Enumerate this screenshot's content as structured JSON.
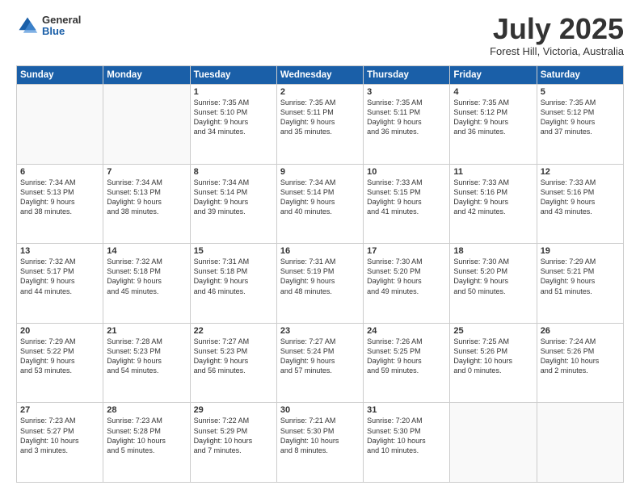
{
  "header": {
    "logo_general": "General",
    "logo_blue": "Blue",
    "month_title": "July 2025",
    "location": "Forest Hill, Victoria, Australia"
  },
  "days_of_week": [
    "Sunday",
    "Monday",
    "Tuesday",
    "Wednesday",
    "Thursday",
    "Friday",
    "Saturday"
  ],
  "weeks": [
    [
      {
        "num": "",
        "info": ""
      },
      {
        "num": "",
        "info": ""
      },
      {
        "num": "1",
        "info": "Sunrise: 7:35 AM\nSunset: 5:10 PM\nDaylight: 9 hours\nand 34 minutes."
      },
      {
        "num": "2",
        "info": "Sunrise: 7:35 AM\nSunset: 5:11 PM\nDaylight: 9 hours\nand 35 minutes."
      },
      {
        "num": "3",
        "info": "Sunrise: 7:35 AM\nSunset: 5:11 PM\nDaylight: 9 hours\nand 36 minutes."
      },
      {
        "num": "4",
        "info": "Sunrise: 7:35 AM\nSunset: 5:12 PM\nDaylight: 9 hours\nand 36 minutes."
      },
      {
        "num": "5",
        "info": "Sunrise: 7:35 AM\nSunset: 5:12 PM\nDaylight: 9 hours\nand 37 minutes."
      }
    ],
    [
      {
        "num": "6",
        "info": "Sunrise: 7:34 AM\nSunset: 5:13 PM\nDaylight: 9 hours\nand 38 minutes."
      },
      {
        "num": "7",
        "info": "Sunrise: 7:34 AM\nSunset: 5:13 PM\nDaylight: 9 hours\nand 38 minutes."
      },
      {
        "num": "8",
        "info": "Sunrise: 7:34 AM\nSunset: 5:14 PM\nDaylight: 9 hours\nand 39 minutes."
      },
      {
        "num": "9",
        "info": "Sunrise: 7:34 AM\nSunset: 5:14 PM\nDaylight: 9 hours\nand 40 minutes."
      },
      {
        "num": "10",
        "info": "Sunrise: 7:33 AM\nSunset: 5:15 PM\nDaylight: 9 hours\nand 41 minutes."
      },
      {
        "num": "11",
        "info": "Sunrise: 7:33 AM\nSunset: 5:16 PM\nDaylight: 9 hours\nand 42 minutes."
      },
      {
        "num": "12",
        "info": "Sunrise: 7:33 AM\nSunset: 5:16 PM\nDaylight: 9 hours\nand 43 minutes."
      }
    ],
    [
      {
        "num": "13",
        "info": "Sunrise: 7:32 AM\nSunset: 5:17 PM\nDaylight: 9 hours\nand 44 minutes."
      },
      {
        "num": "14",
        "info": "Sunrise: 7:32 AM\nSunset: 5:18 PM\nDaylight: 9 hours\nand 45 minutes."
      },
      {
        "num": "15",
        "info": "Sunrise: 7:31 AM\nSunset: 5:18 PM\nDaylight: 9 hours\nand 46 minutes."
      },
      {
        "num": "16",
        "info": "Sunrise: 7:31 AM\nSunset: 5:19 PM\nDaylight: 9 hours\nand 48 minutes."
      },
      {
        "num": "17",
        "info": "Sunrise: 7:30 AM\nSunset: 5:20 PM\nDaylight: 9 hours\nand 49 minutes."
      },
      {
        "num": "18",
        "info": "Sunrise: 7:30 AM\nSunset: 5:20 PM\nDaylight: 9 hours\nand 50 minutes."
      },
      {
        "num": "19",
        "info": "Sunrise: 7:29 AM\nSunset: 5:21 PM\nDaylight: 9 hours\nand 51 minutes."
      }
    ],
    [
      {
        "num": "20",
        "info": "Sunrise: 7:29 AM\nSunset: 5:22 PM\nDaylight: 9 hours\nand 53 minutes."
      },
      {
        "num": "21",
        "info": "Sunrise: 7:28 AM\nSunset: 5:23 PM\nDaylight: 9 hours\nand 54 minutes."
      },
      {
        "num": "22",
        "info": "Sunrise: 7:27 AM\nSunset: 5:23 PM\nDaylight: 9 hours\nand 56 minutes."
      },
      {
        "num": "23",
        "info": "Sunrise: 7:27 AM\nSunset: 5:24 PM\nDaylight: 9 hours\nand 57 minutes."
      },
      {
        "num": "24",
        "info": "Sunrise: 7:26 AM\nSunset: 5:25 PM\nDaylight: 9 hours\nand 59 minutes."
      },
      {
        "num": "25",
        "info": "Sunrise: 7:25 AM\nSunset: 5:26 PM\nDaylight: 10 hours\nand 0 minutes."
      },
      {
        "num": "26",
        "info": "Sunrise: 7:24 AM\nSunset: 5:26 PM\nDaylight: 10 hours\nand 2 minutes."
      }
    ],
    [
      {
        "num": "27",
        "info": "Sunrise: 7:23 AM\nSunset: 5:27 PM\nDaylight: 10 hours\nand 3 minutes."
      },
      {
        "num": "28",
        "info": "Sunrise: 7:23 AM\nSunset: 5:28 PM\nDaylight: 10 hours\nand 5 minutes."
      },
      {
        "num": "29",
        "info": "Sunrise: 7:22 AM\nSunset: 5:29 PM\nDaylight: 10 hours\nand 7 minutes."
      },
      {
        "num": "30",
        "info": "Sunrise: 7:21 AM\nSunset: 5:30 PM\nDaylight: 10 hours\nand 8 minutes."
      },
      {
        "num": "31",
        "info": "Sunrise: 7:20 AM\nSunset: 5:30 PM\nDaylight: 10 hours\nand 10 minutes."
      },
      {
        "num": "",
        "info": ""
      },
      {
        "num": "",
        "info": ""
      }
    ]
  ]
}
